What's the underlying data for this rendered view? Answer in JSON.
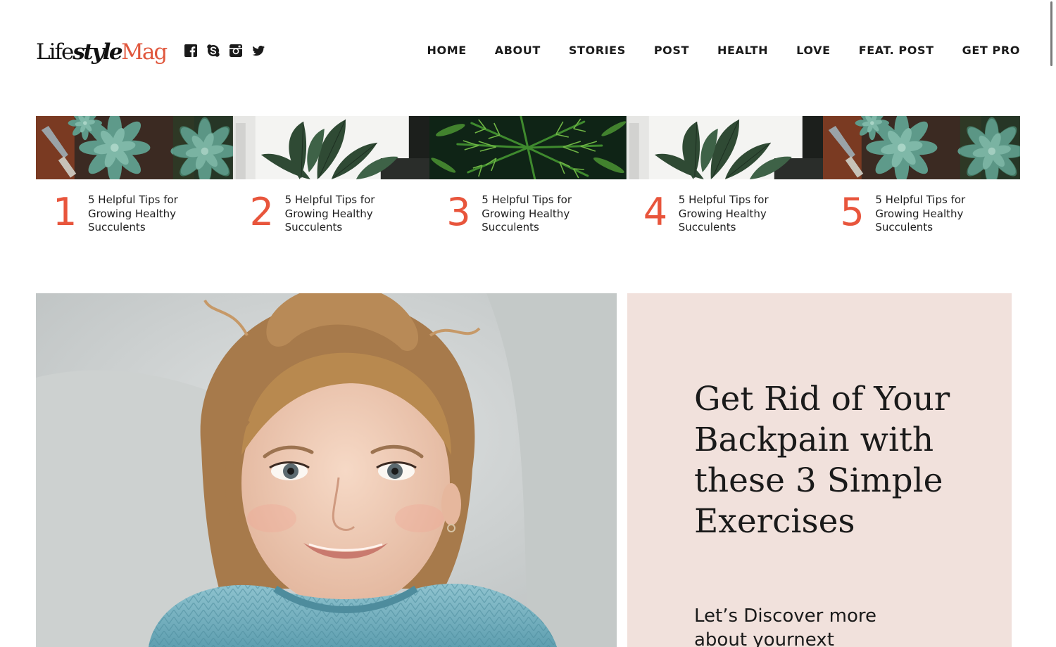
{
  "header": {
    "logo": {
      "part1": "Life",
      "part2": "style",
      "part3": "Mag"
    },
    "social": [
      {
        "icon": "facebook-icon"
      },
      {
        "icon": "skype-icon"
      },
      {
        "icon": "instagram-icon"
      },
      {
        "icon": "twitter-icon"
      }
    ],
    "nav": [
      "HOME",
      "ABOUT",
      "STORIES",
      "POST",
      "HEALTH",
      "LOVE",
      "FEAT. POST",
      "GET PRO"
    ]
  },
  "trending": [
    {
      "num": "1",
      "title": "5 Helpful Tips for Growing Healthy Succulents",
      "image": "succulents-photo"
    },
    {
      "num": "2",
      "title": "5 Helpful Tips for Growing Healthy Succulents",
      "image": "houseplant-photo"
    },
    {
      "num": "3",
      "title": "5 Helpful Tips for Growing Healthy Succulents",
      "image": "palm-leaves-photo"
    },
    {
      "num": "4",
      "title": "5 Helpful Tips for Growing Healthy Succulents",
      "image": "houseplant-photo"
    },
    {
      "num": "5",
      "title": "5 Helpful Tips for Growing Healthy Succulents",
      "image": "succulents-photo"
    }
  ],
  "feature": {
    "title": "Get Rid of Your Backpain with these 3 Simple Exercises",
    "subtitle": "Let’s Discover more about yournext",
    "image": "smiling-girl-photo"
  },
  "colors": {
    "accent": "#e8553c",
    "panel_bg": "#f1e1dc",
    "text": "#1a1a1a"
  }
}
